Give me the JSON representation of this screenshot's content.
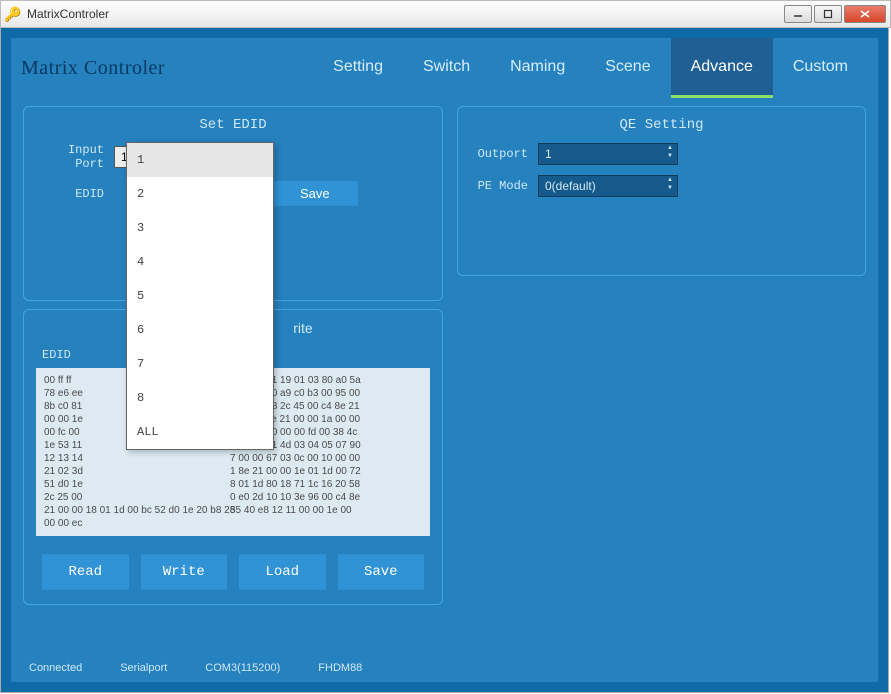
{
  "window": {
    "title": "MatrixControler"
  },
  "header": {
    "app_title": "Matrix Controler"
  },
  "tabs": {
    "setting": "Setting",
    "switch": "Switch",
    "naming": "Naming",
    "scene": "Scene",
    "advance": "Advance",
    "custom": "Custom"
  },
  "set_edid": {
    "title": "Set EDID",
    "input_port_label": "Input Port",
    "input_port_value": "1",
    "edid_label": "EDID",
    "save_label": "Save",
    "dropdown_items": [
      "1",
      "2",
      "3",
      "4",
      "5",
      "6",
      "7",
      "8",
      "ALL"
    ]
  },
  "edid_rw": {
    "title_suffix": "rite",
    "edid_select_label": "EDID",
    "hex_left": "00 ff ff\n78 e6 ee\n8b c0 81\n00 00 1e\n00 fc 00\n1e 53 11\n12 13 14\n21 02 3d\n51 d0 1e\n2c 25 00\n21 00 00 18 01 1d 00 bc 52 d0 1e 20 b8 28\n00 00 ec",
    "hex_right": "e 00 00 01 19 01 03 80 a0 5a\n0 40 a9 40 a9 c0 b3 00 95 00\n7 2d 40 58 2c 45 00 c4 8e 21\n8 00 c4 8e 21 00 00 1a 00 00\n0 20 20 00 00 00 fd 00 38 4c\n5 03 22 71 4d 03 04 05 07 90\n7 00 00 67 03 0c 00 10 00 00\n1 8e 21 00 00 1e 01 1d 00 72\n8 01 1d 80 18 71 1c 16 20 58\n0 e0 2d 10 10 3e 96 00 c4 8e\n55 40 e8 12 11 00 00 1e 00",
    "read_label": "Read",
    "write_label": "Write",
    "load_label": "Load",
    "save_label": "Save"
  },
  "qe": {
    "title": "QE Setting",
    "outport_label": "Outport",
    "outport_value": "1",
    "pemode_label": "PE Mode",
    "pemode_value": "0(default)"
  },
  "status": {
    "connected": "Connected",
    "serialport": "Serialport",
    "com": "COM3(115200)",
    "device": "FHDM88"
  }
}
